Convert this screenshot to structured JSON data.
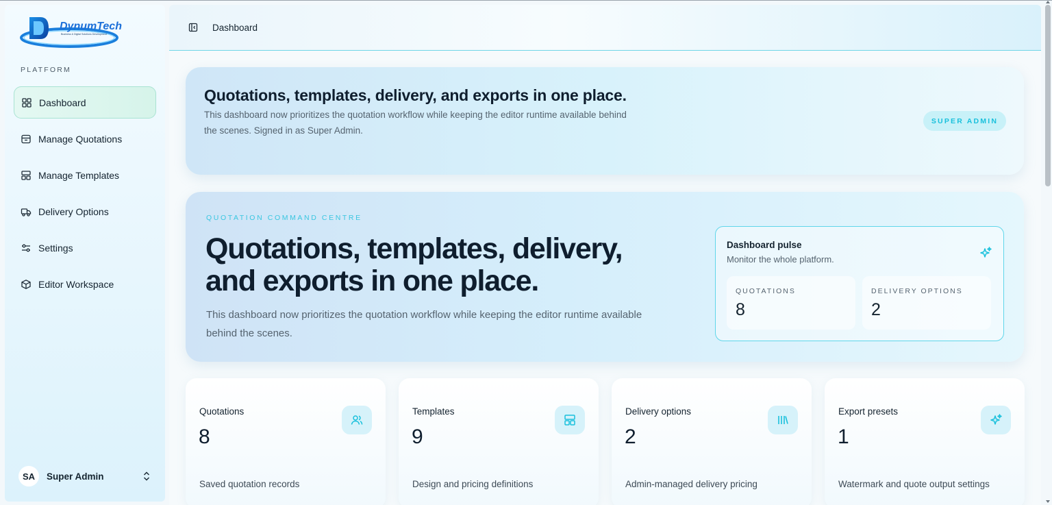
{
  "app": {
    "logo_text": "DynumTech",
    "logo_tagline": "Business & Digital Solutions Development"
  },
  "sidebar": {
    "section_label": "PLATFORM",
    "items": [
      {
        "label": "Dashboard",
        "icon": "grid-icon",
        "active": true
      },
      {
        "label": "Manage Quotations",
        "icon": "inbox-icon"
      },
      {
        "label": "Manage Templates",
        "icon": "layout-icon"
      },
      {
        "label": "Delivery Options",
        "icon": "truck-icon"
      },
      {
        "label": "Settings",
        "icon": "sliders-icon"
      },
      {
        "label": "Editor Workspace",
        "icon": "package-icon"
      }
    ],
    "user": {
      "initials": "SA",
      "name": "Super Admin"
    }
  },
  "header": {
    "breadcrumb": "Dashboard"
  },
  "hero_banner": {
    "title": "Quotations, templates, delivery, and exports in one place.",
    "description": "This dashboard now prioritizes the quotation workflow while keeping the editor runtime available behind the scenes. Signed in as Super Admin.",
    "badge": "SUPER ADMIN"
  },
  "command_centre": {
    "eyebrow": "QUOTATION COMMAND CENTRE",
    "title": "Quotations, templates, delivery, and exports in one place.",
    "description": "This dashboard now prioritizes the quotation workflow while keeping the editor runtime available behind the scenes.",
    "pulse": {
      "title": "Dashboard pulse",
      "subtitle": "Monitor the whole platform.",
      "stats": [
        {
          "label": "QUOTATIONS",
          "value": "8"
        },
        {
          "label": "DELIVERY OPTIONS",
          "value": "2"
        }
      ]
    }
  },
  "stat_cards": [
    {
      "title": "Quotations",
      "value": "8",
      "description": "Saved quotation records",
      "icon": "users-icon"
    },
    {
      "title": "Templates",
      "value": "9",
      "description": "Design and pricing definitions",
      "icon": "layout-icon"
    },
    {
      "title": "Delivery options",
      "value": "2",
      "description": "Admin-managed delivery pricing",
      "icon": "library-icon"
    },
    {
      "title": "Export presets",
      "value": "1",
      "description": "Watermark and quote output settings",
      "icon": "sparkles-icon"
    }
  ],
  "colors": {
    "accent": "#19c0dc",
    "text_primary": "#0f1e2e",
    "active_nav_bg": "#d6f4ea"
  }
}
